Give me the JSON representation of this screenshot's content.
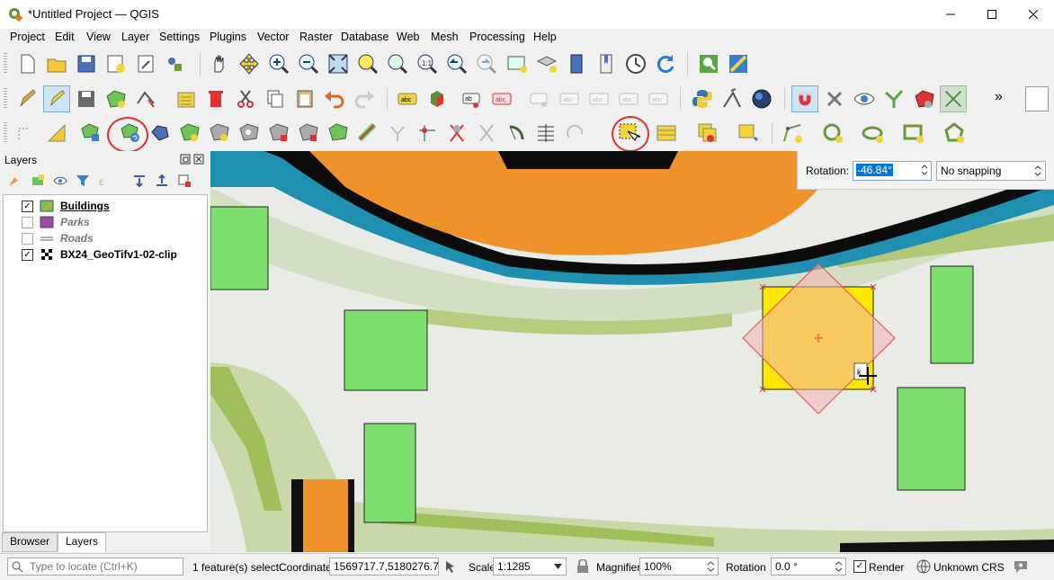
{
  "window": {
    "title": "*Untitled Project — QGIS",
    "controls": [
      "minimize-icon",
      "maximize-icon",
      "close-icon"
    ]
  },
  "menubar": {
    "items": [
      "Project",
      "Edit",
      "View",
      "Layer",
      "Settings",
      "Plugins",
      "Vector",
      "Raster",
      "Database",
      "Web",
      "Mesh",
      "Processing",
      "Help"
    ]
  },
  "toolbars": {
    "overflow_label": "»",
    "row1_icons": [
      "new-project-icon",
      "open-project-icon",
      "save-project-icon",
      "save-as-icon",
      "print-layout-icon",
      "style-manager-icon",
      "pan-icon",
      "pan-to-selection-icon",
      "zoom-in-icon",
      "zoom-out-icon",
      "zoom-full-icon",
      "zoom-to-selection-icon",
      "zoom-to-layer-icon",
      "zoom-native-icon",
      "zoom-last-icon",
      "zoom-next-icon",
      "new-map-view-icon",
      "new-3d-map-view-icon",
      "temporal-controller-icon",
      "bookmarks-icon",
      "refresh-icon",
      "identify-icon",
      "measure-icon"
    ],
    "row2_icons": [
      "current-edits-icon",
      "toggle-editing-icon",
      "save-edits-icon",
      "add-polygon-feature-icon",
      "vertex-tool-icon",
      "modify-attributes-icon",
      "delete-selected-icon",
      "cut-features-icon",
      "copy-features-icon",
      "paste-features-icon",
      "undo-icon",
      "redo-icon",
      "label-toolbar-icon",
      "python-console-icon",
      "georeferencer-icon",
      "globe-icon",
      "snapping-magnet-icon",
      "digitizing-icon",
      "visibility-icon",
      "tracing-icon",
      "shape-digitizing-icon",
      "topology-icon"
    ],
    "row3_icons": [
      "advanced-digitizing-icon",
      "cad-tool-icon",
      "move-feature-icon",
      "rotate-feature-icon",
      "simplify-icon",
      "add-ring-icon",
      "add-part-icon",
      "fill-ring-icon",
      "delete-ring-icon",
      "delete-part-icon",
      "reshape-icon",
      "offset-curve-icon",
      "split-features-icon",
      "split-parts-icon",
      "merge-features-icon",
      "merge-attributes-icon",
      "rotate-point-symbols-icon",
      "offset-point-symbols-icon",
      "select-features-icon",
      "select-by-value-icon",
      "deselect-icon",
      "pan-map-icon",
      "shape-circle-icon",
      "shape-ellipse-icon",
      "shape-rectangle-icon",
      "shape-polygon-icon"
    ]
  },
  "layers_panel": {
    "title": "Layers",
    "layers": [
      {
        "name": "Buildings",
        "checked": "✓",
        "style": "bold-underline",
        "icon": "polygon-green-edit-icon"
      },
      {
        "name": "Parks",
        "checked": "",
        "style": "italic-grey",
        "icon": "polygon-purple-icon"
      },
      {
        "name": "Roads",
        "checked": "",
        "style": "italic-grey",
        "icon": "line-grey-icon"
      },
      {
        "name": "BX24_GeoTifv1-02-clip",
        "checked": "✓",
        "style": "bold",
        "icon": "raster-icon"
      }
    ],
    "tabs": [
      "Browser",
      "Layers"
    ],
    "active_tab": "Layers"
  },
  "rotation_widget": {
    "label": "Rotation:",
    "value": "-46.84°",
    "snapping": "No snapping"
  },
  "statusbar": {
    "locate_placeholder": "Type to locate (Ctrl+K)",
    "selection_text": "1 feature(s) select",
    "coordinate_label": "Coordinate",
    "coordinate_value": "1569717.7,5180276.7",
    "scale_label": "Scale",
    "scale_value": "1:1285",
    "magnifier_label": "Magnifier",
    "magnifier_value": "100%",
    "rotation_label": "Rotation",
    "rotation_value": "0.0 °",
    "render_label": "Render",
    "render_checked": "✓",
    "crs_label": "Unknown CRS"
  },
  "colors": {
    "building_fill": "#7de06e",
    "selected_fill": "#ffe800",
    "rotation_preview": "#f2b3b0",
    "highlight_circle": "#e03030",
    "orange_raster": "#f0922a",
    "teal_raster": "#1e8fb0"
  }
}
